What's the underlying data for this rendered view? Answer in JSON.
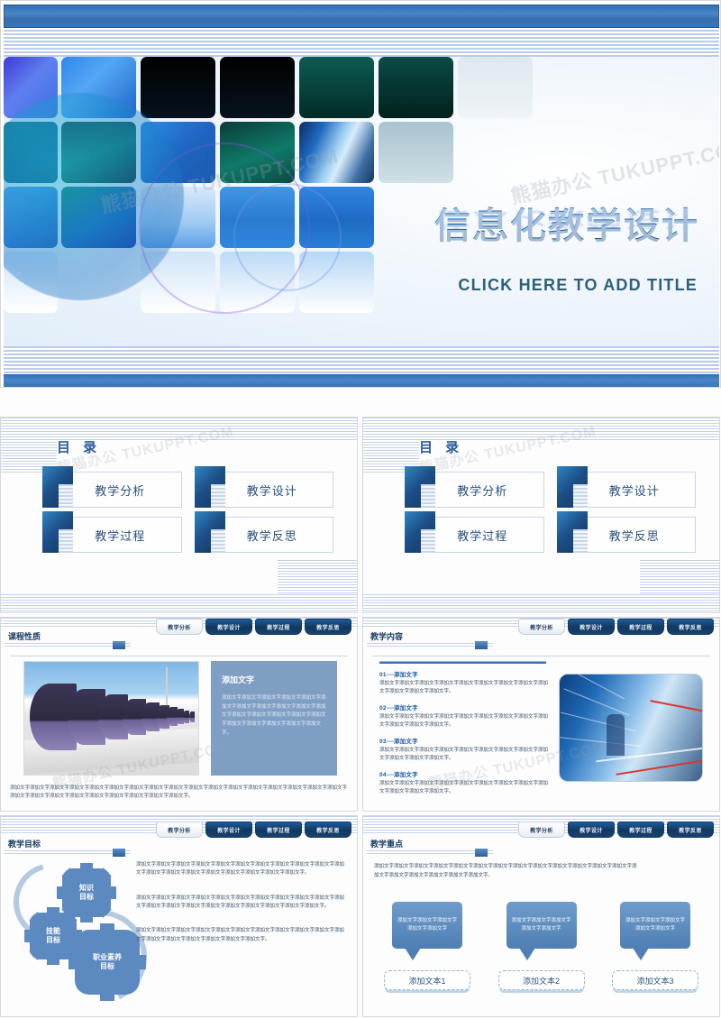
{
  "theme": {
    "accent_blue": "#2f6fb5",
    "dark_blue": "#16375f",
    "panel_blue": "#7e9ec4",
    "gear_blue": "#5c8ac0",
    "title_text_blue": "#1e5fa8",
    "subtitle_teal": "#2f6079"
  },
  "watermark": {
    "text": "熊猫办公 TUKUPPT.COM"
  },
  "slide_title": {
    "main_title": "信息化教学设计",
    "subtitle": "CLICK HERE TO ADD TITLE"
  },
  "catalogue": {
    "heading": "目 录",
    "items": [
      {
        "label": "教学分析"
      },
      {
        "label": "教学设计"
      },
      {
        "label": "教学过程"
      },
      {
        "label": "教学反思"
      }
    ]
  },
  "tabs": [
    {
      "label": "教学分析",
      "active": true
    },
    {
      "label": "教学设计",
      "active": false
    },
    {
      "label": "教学过程",
      "active": false
    },
    {
      "label": "教学反思",
      "active": false
    }
  ],
  "slide_course_nature": {
    "title": "课程性质",
    "panel_heading": "添加文字",
    "panel_body": "添加文字添加文字添加文字添加文字添加文字添加文字添加文字添加文字添加文字添加文字添加文字添加文字添加文字添加文字添加文字添加文字添加文字添加文字添加文字添加文字添加文字。",
    "bottom_paragraph": "添加文字添加文字添加文字添加文字添加文字添加文字添加文字添加文字添加文字添加文字添加文字添加文字添加文字添加文字添加文字添加文字添加文字添加文字添加文字添加文字添加文字添加文字添加文字添加文字添加文字添加文字。"
  },
  "slide_teaching_content": {
    "title": "教学内容",
    "items": [
      {
        "num": "01",
        "dash": "-----",
        "label": "添加文字",
        "body": "添加文字添加文字添加文字添加文字添加文字添加文字添加文字添加文字添加文字添加文字添加文字添加文字。"
      },
      {
        "num": "02",
        "dash": "-----",
        "label": "添加文字",
        "body": "添加文字添加文字添加文字添加文字添加文字添加文字添加文字添加文字添加文字添加文字添加文字添加文字。"
      },
      {
        "num": "03",
        "dash": "-----",
        "label": "添加文字",
        "body": "添加文字添加文字添加文字添加文字添加文字添加文字添加文字添加文字添加文字添加文字添加文字添加文字。"
      },
      {
        "num": "04",
        "dash": "-----",
        "label": "添加文字",
        "body": "添加文字添加文字添加文字添加文字添加文字添加文字添加文字添加文字添加文字添加文字添加文字添加文字。"
      }
    ]
  },
  "slide_teaching_goal": {
    "title": "教学目标",
    "gears": [
      {
        "line1": "知识",
        "line2": "目标"
      },
      {
        "line1": "技能",
        "line2": "目标"
      },
      {
        "line1": "职业素养",
        "line2": "目标"
      }
    ],
    "paragraphs": [
      "添加文字添加文字添加文字添加文字添加文字添加文字添加文字添加文字添加文字添加文字添加文字添加文字添加文字添加文字添加文字添加文字添加文字添加文字添加文字。",
      "添加文字添加文字添加文字添加文字添加文字添加文字添加文字添加文字添加文字添加文字添加文字添加文字添加文字添加文字添加文字添加文字添加文字添加文字添加文字添加文字。",
      "添加文字添加文字添加文字添加文字添加文字添加文字添加文字添加文字添加文字添加文字添加文字添加文字添加文字添加文字添加文字添加文字添加文字。"
    ]
  },
  "slide_key_points": {
    "title": "教学重点",
    "intro": "添加文字添加文字添加文字添加文字添加文字添加文字添加文字添加文字添加文字添加文字添加文字添加文字添加文字添加文字添加文字添加文字添加文字添加文字添加文字。",
    "columns": [
      {
        "bubble": "添加文字添加文字添加文字添加文字添加文字",
        "button": "添加文本1"
      },
      {
        "bubble": "添加文字添加文字添加文字添加文字添加文字",
        "button": "添加文本2"
      },
      {
        "bubble": "添加文字添加文字添加文字添加文字添加文字",
        "button": "添加文本3"
      }
    ]
  }
}
